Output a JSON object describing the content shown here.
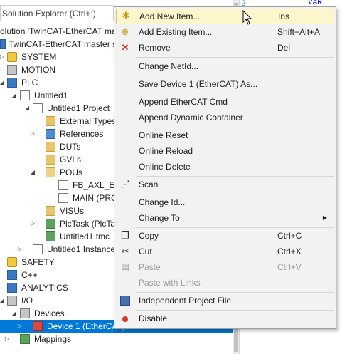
{
  "explorer": {
    "search_placeholder": "Solution Explorer (Ctrl+;)",
    "items": [
      {
        "label": "olution 'TwinCAT-EtherCAT ma",
        "icon": "solution-icon"
      },
      {
        "label": "TwinCAT-EtherCAT master s",
        "icon": "project-icon"
      },
      {
        "label": "SYSTEM",
        "icon": "system-icon"
      },
      {
        "label": "MOTION",
        "icon": "motion-icon"
      },
      {
        "label": "PLC",
        "icon": "plc-icon"
      },
      {
        "label": "Untitled1",
        "icon": "plc-project-icon"
      },
      {
        "label": "Untitled1 Project",
        "icon": "plc-project-node-icon"
      },
      {
        "label": "External Types",
        "icon": "folder-icon"
      },
      {
        "label": "References",
        "icon": "references-icon"
      },
      {
        "label": "DUTs",
        "icon": "folder-icon"
      },
      {
        "label": "GVLs",
        "icon": "folder-icon"
      },
      {
        "label": "POUs",
        "icon": "folder-open-icon"
      },
      {
        "label": "FB_AXL_E_",
        "icon": "function-block-icon"
      },
      {
        "label": "MAIN (PRG",
        "icon": "program-icon"
      },
      {
        "label": "VISUs",
        "icon": "folder-icon"
      },
      {
        "label": "PlcTask (PlcTas",
        "icon": "task-icon"
      },
      {
        "label": "Untitled1.tmc",
        "icon": "tmc-file-icon"
      },
      {
        "label": "Untitled1 Instance",
        "icon": "instance-icon"
      },
      {
        "label": "SAFETY",
        "icon": "safety-icon"
      },
      {
        "label": "C++",
        "icon": "cpp-icon"
      },
      {
        "label": "ANALYTICS",
        "icon": "analytics-icon"
      },
      {
        "label": "I/O",
        "icon": "io-icon"
      },
      {
        "label": "Devices",
        "icon": "devices-icon"
      },
      {
        "label": "Device 1 (EtherCAT)",
        "icon": "ethercat-device-icon"
      },
      {
        "label": "Mappings",
        "icon": "mappings-icon"
      }
    ]
  },
  "editor": {
    "line_number": "2",
    "code": "VAR"
  },
  "context_menu": {
    "items": [
      {
        "label": "Add New Item...",
        "shortcut": "Ins",
        "icon": "add-new-item-icon"
      },
      {
        "label": "Add Existing Item...",
        "shortcut": "Shift+Alt+A",
        "icon": "add-existing-item-icon"
      },
      {
        "label": "Remove",
        "shortcut": "Del",
        "icon": "remove-icon"
      },
      {
        "label": "Change NetId...",
        "shortcut": "",
        "icon": ""
      },
      {
        "label": "Save Device 1 (EtherCAT) As...",
        "shortcut": "",
        "icon": ""
      },
      {
        "label": "Append EtherCAT Cmd",
        "shortcut": "",
        "icon": ""
      },
      {
        "label": "Append Dynamic Container",
        "shortcut": "",
        "icon": ""
      },
      {
        "label": "Online Reset",
        "shortcut": "",
        "icon": ""
      },
      {
        "label": "Online Reload",
        "shortcut": "",
        "icon": ""
      },
      {
        "label": "Online Delete",
        "shortcut": "",
        "icon": ""
      },
      {
        "label": "Scan",
        "shortcut": "",
        "icon": "scan-icon"
      },
      {
        "label": "Change Id...",
        "shortcut": "",
        "icon": ""
      },
      {
        "label": "Change To",
        "shortcut": "",
        "icon": ""
      },
      {
        "label": "Copy",
        "shortcut": "Ctrl+C",
        "icon": "copy-icon"
      },
      {
        "label": "Cut",
        "shortcut": "Ctrl+X",
        "icon": "cut-icon"
      },
      {
        "label": "Paste",
        "shortcut": "Ctrl+V",
        "icon": "paste-icon"
      },
      {
        "label": "Paste with Links",
        "shortcut": "",
        "icon": ""
      },
      {
        "label": "Independent Project File",
        "shortcut": "",
        "icon": "save-icon"
      },
      {
        "label": "Disable",
        "shortcut": "",
        "icon": "disable-icon"
      }
    ]
  },
  "colors": {
    "selection": "#0078d7",
    "menu_hover": "#fff6cc",
    "menu_background": "#f2f2f2"
  }
}
